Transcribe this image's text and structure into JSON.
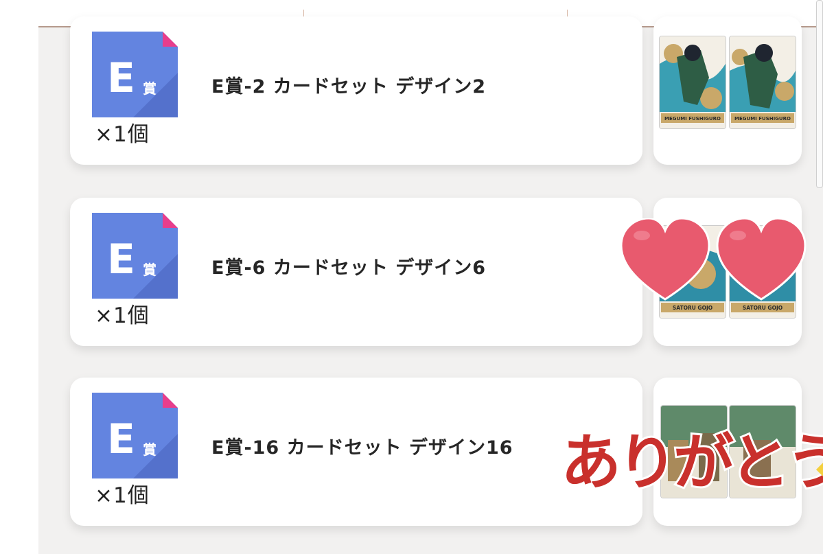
{
  "prize_list": {
    "items": [
      {
        "badge_letter": "E",
        "badge_kanji": "賞",
        "name": "E賞-2 カードセット デザイン2",
        "quantity": "×1個",
        "card_name": "MEGUMI FUSHIGURO"
      },
      {
        "badge_letter": "E",
        "badge_kanji": "賞",
        "name": "E賞-6 カードセット デザイン6",
        "quantity": "×1個",
        "card_name": "SATORU GOJO"
      },
      {
        "badge_letter": "E",
        "badge_kanji": "賞",
        "name": "E賞-16 カードセット デザイン16",
        "quantity": "×1個"
      }
    ]
  },
  "overlay": {
    "sticker_text": "ありがとう",
    "hearts_icon": "heart-icon"
  },
  "colors": {
    "badge_blue": "#6384e0",
    "badge_corner": "#e83e8c",
    "heart": "#e85a6e",
    "sticker_red": "#c9302c"
  }
}
